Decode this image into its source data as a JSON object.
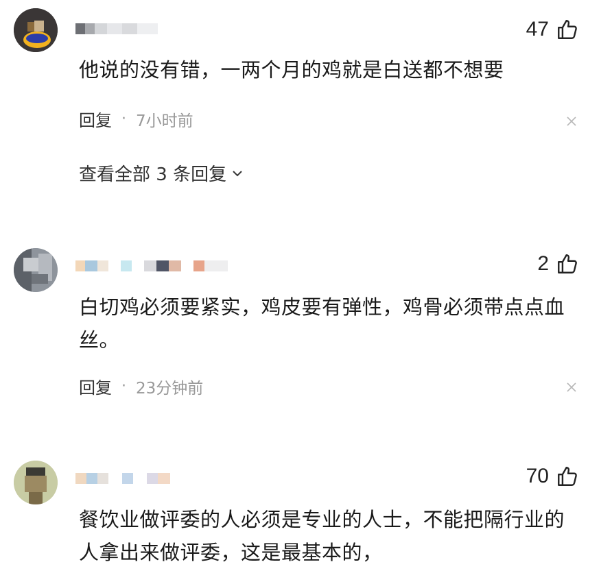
{
  "comments": [
    {
      "username": "",
      "likes": "47",
      "text": "他说的没有错，一两个月的鸡就是白送都不想要",
      "reply_label": "回复",
      "separator": "·",
      "time": "7小时前",
      "view_replies": "查看全部 3 条回复"
    },
    {
      "username": "",
      "likes": "2",
      "text": "白切鸡必须要紧实，鸡皮要有弹性，鸡骨必须带点点血丝。",
      "reply_label": "回复",
      "separator": "·",
      "time": "23分钟前"
    },
    {
      "username": "",
      "likes": "70",
      "text": "餐饮业做评委的人必须是专业的人士，不能把隔行业的人拿出来做评委，这是最基本的，"
    }
  ],
  "icons": {
    "like": "thumbs-up-icon",
    "close": "close-icon",
    "expand": "chevron-down-icon"
  },
  "colors": {
    "text": "#1a1a1a",
    "meta": "#999999"
  }
}
